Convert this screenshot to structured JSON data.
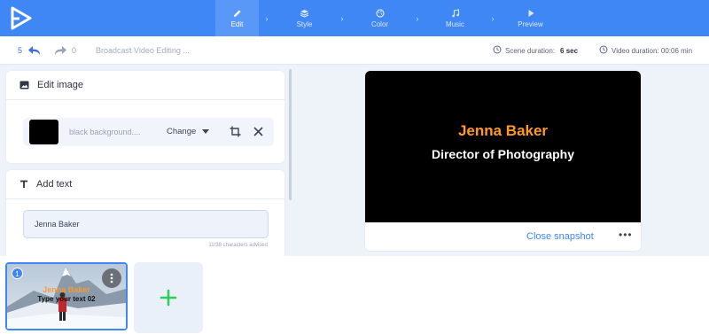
{
  "nav": {
    "steps": [
      {
        "label": "Edit",
        "icon": "pencil-icon",
        "active": true
      },
      {
        "label": "Style",
        "icon": "layers-icon",
        "active": false
      },
      {
        "label": "Color",
        "icon": "palette-icon",
        "active": false
      },
      {
        "label": "Music",
        "icon": "music-note-icon",
        "active": false
      },
      {
        "label": "Preview",
        "icon": "play-icon",
        "active": false
      }
    ]
  },
  "toolbar": {
    "undo_count": "5",
    "redo_count": "0",
    "project_name": "Broadcast Video Editing ...",
    "scene_duration_label": "Scene duration:",
    "scene_duration_value": "6 sec",
    "video_duration_label": "Video duration: 00:06 min"
  },
  "edit_image": {
    "title": "Edit image",
    "file_name": "black background....",
    "change_label": "Change"
  },
  "add_text": {
    "title": "Add text",
    "value": "Jenna Baker",
    "hint": "11/38 characters advised"
  },
  "preview": {
    "name": "Jenna Baker",
    "role": "Director of Photography",
    "close_label": "Close snapshot",
    "more_label": "•••"
  },
  "timeline": {
    "scenes": [
      {
        "number": "1",
        "line1": "Jenna Baker",
        "line2": "Type your text 02"
      }
    ]
  },
  "colors": {
    "accent": "#3f87f5",
    "title_orange": "#ff9a26",
    "add_green": "#2ecc5a"
  }
}
